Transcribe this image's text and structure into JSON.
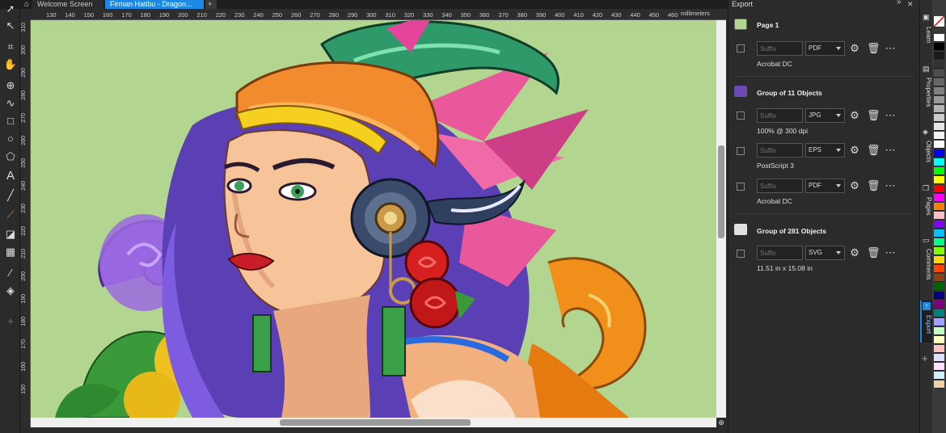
{
  "tabs": [
    {
      "label": "Welcome Screen",
      "active": false
    },
    {
      "label": "Firman Hatibu - Dragon...",
      "active": true
    }
  ],
  "ruler": {
    "h_ticks": [
      "130",
      "140",
      "150",
      "160",
      "170",
      "180",
      "190",
      "200",
      "210",
      "220",
      "230",
      "240",
      "250",
      "260",
      "270",
      "280",
      "290",
      "300",
      "310",
      "320",
      "330",
      "340",
      "350",
      "360",
      "370",
      "380",
      "390",
      "400",
      "410",
      "420",
      "430",
      "440",
      "450",
      "460"
    ],
    "v_ticks": [
      "310",
      "300",
      "290",
      "280",
      "270",
      "260",
      "250",
      "240",
      "230",
      "220",
      "210",
      "200",
      "190",
      "180",
      "170",
      "160",
      "150"
    ],
    "unit": "millimeters"
  },
  "docker": {
    "title": "Export",
    "items": [
      {
        "title": "Page 1",
        "rows": [
          {
            "suffix_placeholder": "Suffix",
            "format": "PDF",
            "info": "Acrobat DC"
          }
        ]
      },
      {
        "title": "Group of 11 Objects",
        "rows": [
          {
            "suffix_placeholder": "Suffix",
            "format": "JPG",
            "info": "100% @ 300 dpi"
          },
          {
            "suffix_placeholder": "Suffix",
            "format": "EPS",
            "info": "PostScript 3"
          },
          {
            "suffix_placeholder": "Suffix",
            "format": "PDF",
            "info": "Acrobat DC"
          }
        ]
      },
      {
        "title": "Group of 281 Objects",
        "rows": [
          {
            "suffix_placeholder": "Suffix",
            "format": "SVG",
            "info": "11.51 in x 15.08 in"
          }
        ]
      }
    ]
  },
  "side_tabs": [
    "Learn",
    "Properties",
    "Objects",
    "Pages",
    "Comments",
    "Export"
  ],
  "palette": [
    "#ffffff",
    "#000000",
    "#1a1a1a",
    "#333333",
    "#4d4d4d",
    "#666666",
    "#808080",
    "#999999",
    "#b3b3b3",
    "#cccccc",
    "#e6e6e6",
    "#f2f2f2",
    "#fafafa",
    "#0000ff",
    "#00ffff",
    "#00ff00",
    "#ffff00",
    "#ff0000",
    "#ff00ff",
    "#ff8000",
    "#ffc0cb",
    "#7f00ff",
    "#00bfff",
    "#00ff80",
    "#80ff00",
    "#ffd700",
    "#ff4500",
    "#8b4513",
    "#006400",
    "#000080",
    "#800080",
    "#008080",
    "#a0a0ff",
    "#c0ffc0",
    "#ffffc0",
    "#ffc0c0",
    "#e0e0ff",
    "#ffe0ff",
    "#d0f0ff",
    "#f0d0a0"
  ],
  "colors": {
    "canvas": "#b2d58f",
    "accent": "#1e88e5"
  }
}
